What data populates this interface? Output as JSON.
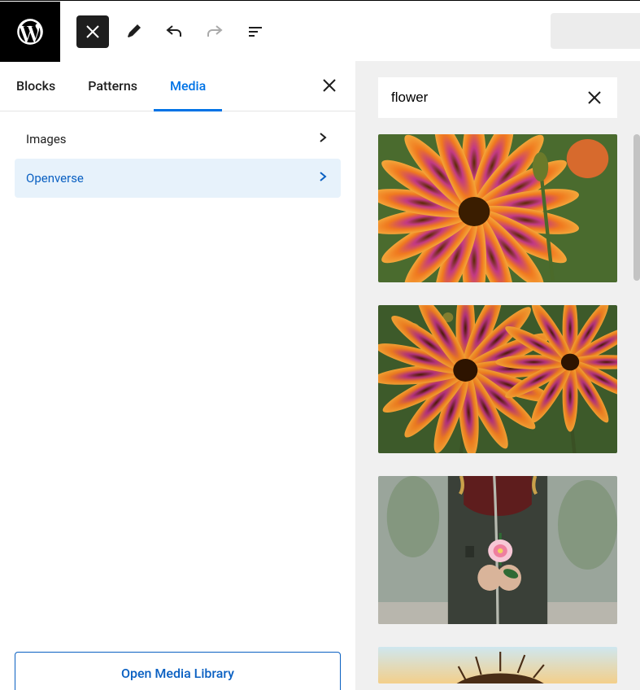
{
  "toolbar": {
    "close_icon": "close-icon",
    "edit_icon": "edit-icon",
    "undo_icon": "undo-icon",
    "redo_icon": "redo-icon",
    "outline_icon": "outline-icon"
  },
  "left_panel": {
    "tabs": [
      "Blocks",
      "Patterns",
      "Media"
    ],
    "active_tab_index": 2,
    "media_nav": [
      {
        "label": "Images",
        "selected": false
      },
      {
        "label": "Openverse",
        "selected": true
      }
    ],
    "open_library_label": "Open Media Library"
  },
  "search": {
    "value": "flower"
  },
  "results": [
    {
      "alt": "Close-up of orange and magenta daisy flowers"
    },
    {
      "alt": "Orange daisy flowers against green foliage"
    },
    {
      "alt": "Person in dark jacket holding a pink camellia flower"
    },
    {
      "alt": "Silhouetted seed head against warm sunset sky"
    }
  ]
}
